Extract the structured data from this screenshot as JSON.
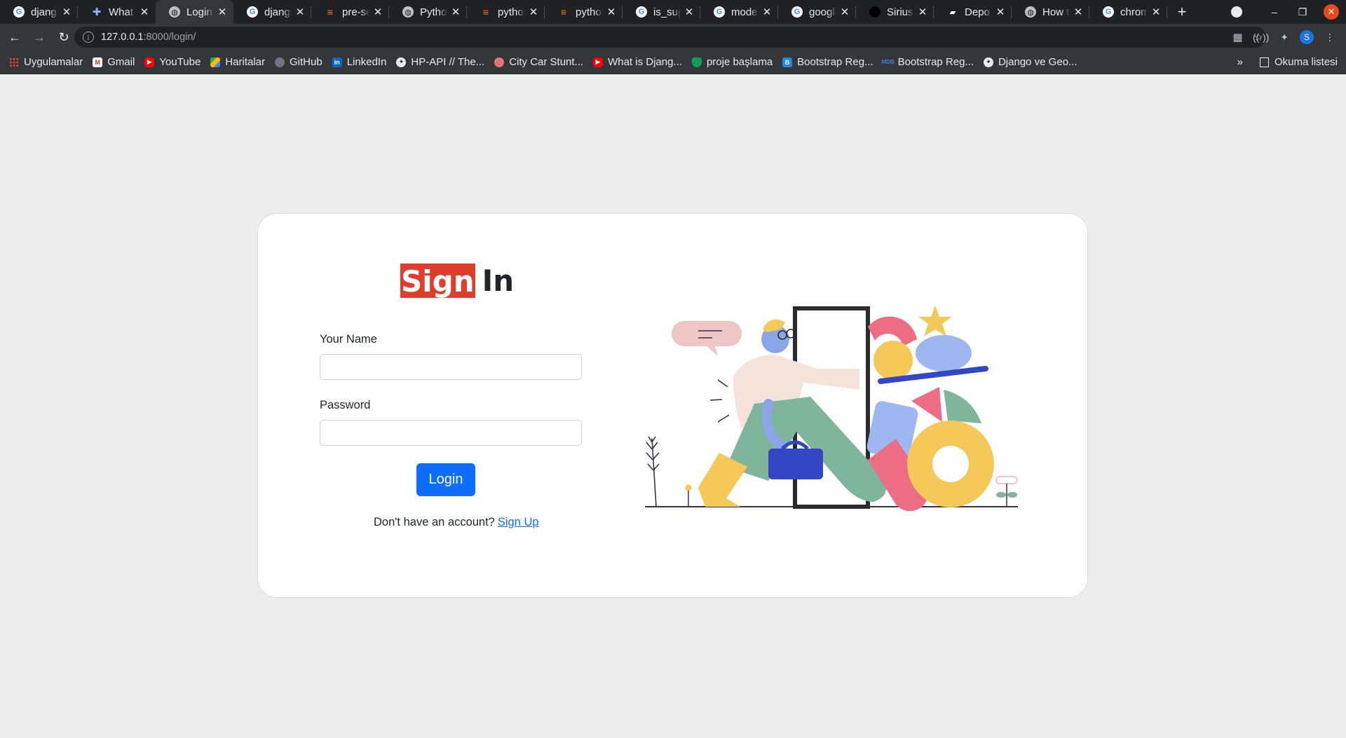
{
  "browser": {
    "tabs": [
      {
        "title": "django",
        "icon": "google-icon",
        "active": false
      },
      {
        "title": "What Y",
        "icon": "star-icon",
        "active": false
      },
      {
        "title": "Login",
        "icon": "globe-icon",
        "active": true
      },
      {
        "title": "django",
        "icon": "google-icon",
        "active": false
      },
      {
        "title": "pre-sel",
        "icon": "stackoverflow-icon",
        "active": false
      },
      {
        "title": "Python",
        "icon": "globe-icon",
        "active": false
      },
      {
        "title": "python",
        "icon": "stackoverflow-icon",
        "active": false
      },
      {
        "title": "python",
        "icon": "stackoverflow-icon",
        "active": false
      },
      {
        "title": "is_supe",
        "icon": "google-icon",
        "active": false
      },
      {
        "title": "model",
        "icon": "google-icon",
        "active": false
      },
      {
        "title": "google",
        "icon": "google-icon",
        "active": false
      },
      {
        "title": "Sirius-S",
        "icon": "github-icon",
        "active": false
      },
      {
        "title": "Depo (",
        "icon": "depo-icon",
        "active": false
      },
      {
        "title": "How to",
        "icon": "globe-icon",
        "active": false
      },
      {
        "title": "chrom",
        "icon": "google-icon",
        "active": false
      }
    ],
    "url_host": "127.0.0.1",
    "url_rest": ":8000/login/",
    "profile_initial": "S",
    "bookmarks": [
      {
        "label": "Uygulamalar",
        "icon": "apps-icon"
      },
      {
        "label": "Gmail",
        "icon": "gmail-icon"
      },
      {
        "label": "YouTube",
        "icon": "youtube-icon"
      },
      {
        "label": "Haritalar",
        "icon": "maps-icon"
      },
      {
        "label": "GitHub",
        "icon": "github-icon"
      },
      {
        "label": "LinkedIn",
        "icon": "linkedin-icon"
      },
      {
        "label": "HP-API // The...",
        "icon": "globe-icon"
      },
      {
        "label": "City Car Stunt...",
        "icon": "game-icon"
      },
      {
        "label": "What is Djang...",
        "icon": "youtube-icon"
      },
      {
        "label": "proje başlama",
        "icon": "project-icon"
      },
      {
        "label": "Bootstrap Reg...",
        "icon": "bootstrap-icon"
      },
      {
        "label": "Bootstrap Reg...",
        "icon": "mdb-icon"
      },
      {
        "label": "Django ve Geo...",
        "icon": "globe-icon"
      }
    ],
    "reading_list": "Okuma listesi"
  },
  "page": {
    "heading_highlight": "Sign",
    "heading_rest": "In",
    "name_label": "Your Name",
    "name_value": "",
    "password_label": "Password",
    "password_value": "",
    "login_button": "Login",
    "no_account_text": "Don't have an account?",
    "signup_link": "Sign Up"
  },
  "colors": {
    "accent_red": "#e03e2d",
    "button_blue": "#0d6efd",
    "page_bg": "#ededed"
  }
}
